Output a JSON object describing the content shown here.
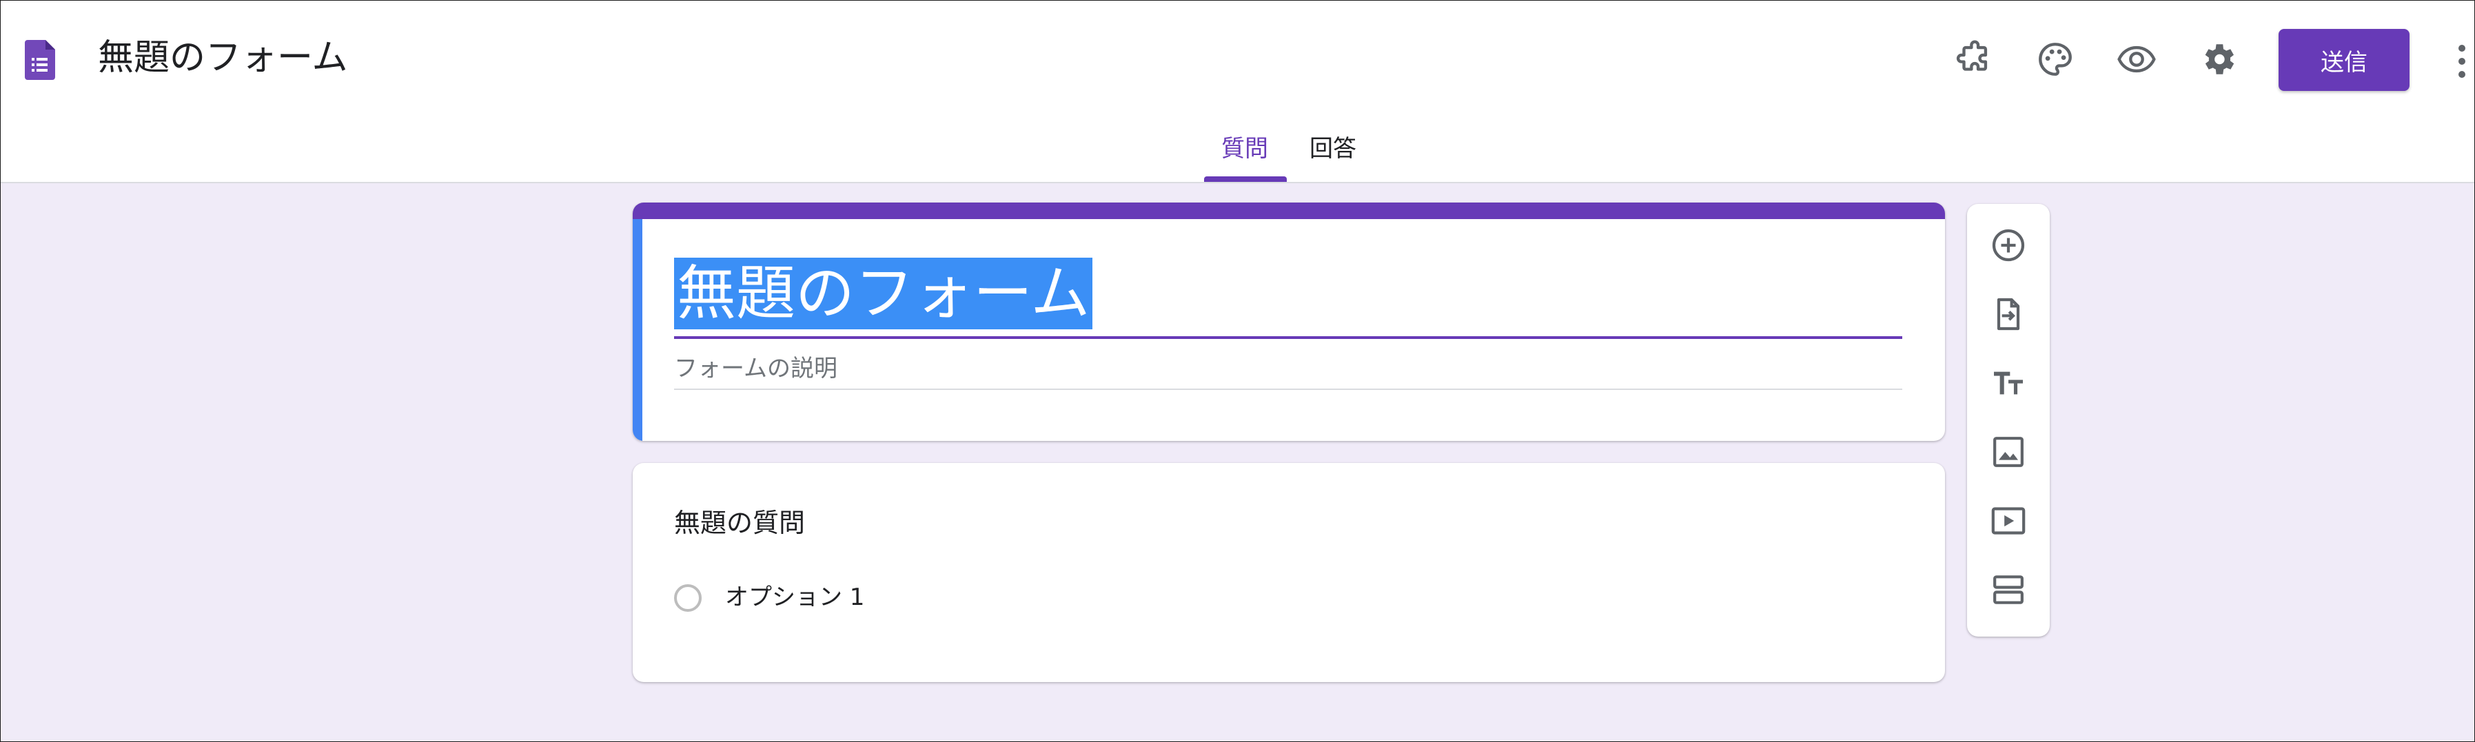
{
  "app": {
    "icon": "google-forms-icon",
    "document_title": "無題のフォーム"
  },
  "toolbar": {
    "icons": [
      "addon-puzzle-icon",
      "palette-icon",
      "preview-eye-icon",
      "settings-gear-icon",
      "more-vert-icon"
    ],
    "send_label": "送信"
  },
  "tabs": [
    {
      "label": "質問",
      "active": true
    },
    {
      "label": "回答",
      "active": false
    }
  ],
  "form": {
    "title": "無題のフォーム",
    "title_selected": true,
    "description_placeholder": "フォームの説明"
  },
  "question": {
    "title": "無題の質問",
    "options": [
      {
        "label": "オプション 1"
      }
    ]
  },
  "side_toolbar": {
    "icons": [
      "add-question-icon",
      "import-questions-icon",
      "add-title-text-icon",
      "add-image-icon",
      "add-video-icon",
      "add-section-icon"
    ]
  },
  "colors": {
    "accent": "#673ab7",
    "background": "#f0ebf8",
    "selection": "#3b8ff6",
    "title_card_left_band": "#4285f4"
  }
}
